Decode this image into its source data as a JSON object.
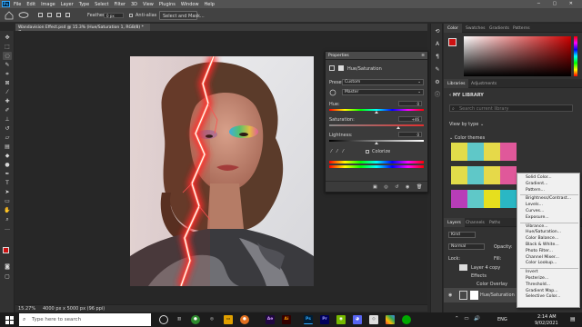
{
  "menubar": {
    "app_icon": "Ps",
    "items": [
      "File",
      "Edit",
      "Image",
      "Layer",
      "Type",
      "Select",
      "Filter",
      "3D",
      "View",
      "Plugins",
      "Window",
      "Help"
    ]
  },
  "options_bar": {
    "feather_label": "Feather:",
    "feather_value": "0 px",
    "antialias_label": "Anti-alias",
    "select_mask_label": "Select and Mask..."
  },
  "document": {
    "tab_title": "Wandavision Effect.psd @ 15.3% (Hue/Saturation 1, RGB/8) *",
    "zoom": "15.27%",
    "doc_info": "4000 px x 5000 px (96 ppi)"
  },
  "properties": {
    "title": "Properties",
    "layer_type": "Hue/Saturation",
    "preset_label": "Preset:",
    "preset_value": "Custom",
    "channel_value": "Master",
    "hue_label": "Hue:",
    "hue_value": "0",
    "saturation_label": "Saturation:",
    "saturation_value": "+46",
    "saturation_fraction": 0.73,
    "lightness_label": "Lightness:",
    "lightness_value": "0",
    "colorize_label": "Colorize"
  },
  "right_panels": {
    "top_tabs": [
      "Color",
      "Swatches",
      "Gradients",
      "Patterns"
    ],
    "mid_tabs": [
      "Libraries",
      "Adjustments"
    ],
    "library_name": "MY LIBRARY",
    "search_placeholder": "Search current library",
    "view_by": "View by type",
    "color_themes": "Color themes",
    "layer_tabs": [
      "Layers",
      "Channels",
      "Paths"
    ],
    "kind_label": "Kind",
    "blend_mode": "Normal",
    "opacity_label": "Opacity:",
    "lock_label": "Lock:",
    "fill_label": "Fill:",
    "layer_names": [
      "Layer 4 copy",
      "Effects",
      "Color Overlay",
      "Hue/Saturation 1"
    ],
    "swatch_colors": [
      [
        "#e1dc4a",
        "#5fc8c8",
        "#e6d949",
        "#e0589a"
      ],
      [
        "#e1dc4a",
        "#5fc8c8",
        "#e6d949",
        "#e0589a"
      ],
      [
        "#b83db8",
        "#5fc8c8",
        "#e6df1e",
        "#2ab7c4"
      ]
    ]
  },
  "adjustment_menu": {
    "groups": [
      [
        "Solid Color...",
        "Gradient...",
        "Pattern..."
      ],
      [
        "Brightness/Contrast...",
        "Levels...",
        "Curves...",
        "Exposure..."
      ],
      [
        "Vibrance...",
        "Hue/Saturation...",
        "Color Balance...",
        "Black & White...",
        "Photo Filter...",
        "Channel Mixer...",
        "Color Lookup..."
      ],
      [
        "Invert",
        "Posterize...",
        "Threshold...",
        "Gradient Map...",
        "Selective Color..."
      ]
    ]
  },
  "taskbar": {
    "search_placeholder": "Type here to search",
    "apps": [
      "Ae",
      "Ai",
      "Ps",
      "Pr"
    ],
    "language": "ENG",
    "time": "2:14 AM",
    "date": "9/02/2021"
  },
  "colors": {
    "foreground": "#cc1111",
    "background": "#000000",
    "picker_hue": "#cc0000"
  }
}
